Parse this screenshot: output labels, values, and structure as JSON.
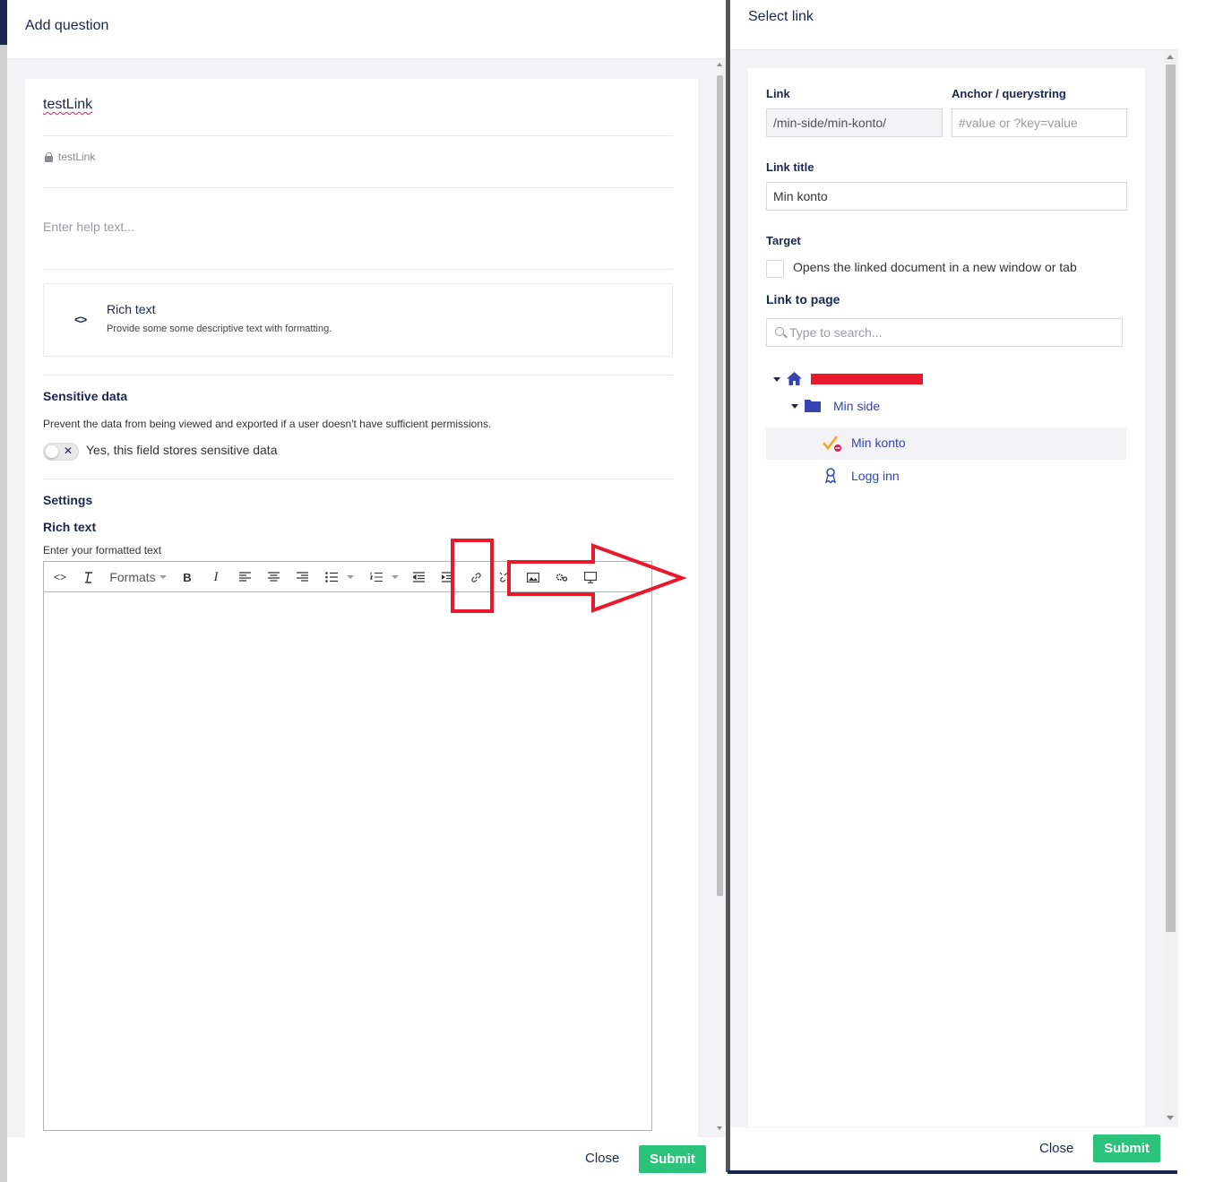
{
  "add_question": {
    "title": "Add question",
    "question_name": "testLink",
    "alias": "testLink",
    "help_placeholder": "Enter help text...",
    "editor_type": {
      "title": "Rich text",
      "description": "Provide some some descriptive text with formatting."
    },
    "sensitive": {
      "title": "Sensitive data",
      "description": "Prevent the data from being viewed and exported if a user doesn't have sufficient permissions.",
      "toggle_label": "Yes, this field stores sensitive data",
      "toggle_on": false
    },
    "settings": {
      "title": "Settings",
      "rte_label": "Rich text",
      "rte_description": "Enter your formatted text",
      "toolbar": {
        "formats_label": "Formats",
        "bold": "B",
        "italic": "I"
      }
    },
    "footer": {
      "close": "Close",
      "submit": "Submit"
    }
  },
  "select_link": {
    "title": "Select link",
    "link": {
      "label": "Link",
      "value": "/min-side/min-konto/"
    },
    "anchor": {
      "label": "Anchor / querystring",
      "placeholder": "#value or ?key=value"
    },
    "link_title": {
      "label": "Link title",
      "value": "Min konto"
    },
    "target": {
      "label": "Target",
      "checkbox_label": "Opens the linked document in a new window or tab",
      "checked": false
    },
    "link_to_page": {
      "label": "Link to page",
      "search_placeholder": "Type to search..."
    },
    "tree": {
      "root_icon": "home-icon",
      "items": [
        {
          "label": "Min side",
          "icon": "folder-icon",
          "expanded": true
        },
        {
          "label": "Min konto",
          "icon": "checkmark-icon",
          "selected": true
        },
        {
          "label": "Logg inn",
          "icon": "user-icon"
        }
      ]
    },
    "footer": {
      "close": "Close",
      "submit": "Submit"
    }
  },
  "colors": {
    "primary_text": "#1b264f",
    "link_blue": "#3544b1",
    "submit_green": "#2bc37c",
    "annotation_red": "#e8192c"
  }
}
